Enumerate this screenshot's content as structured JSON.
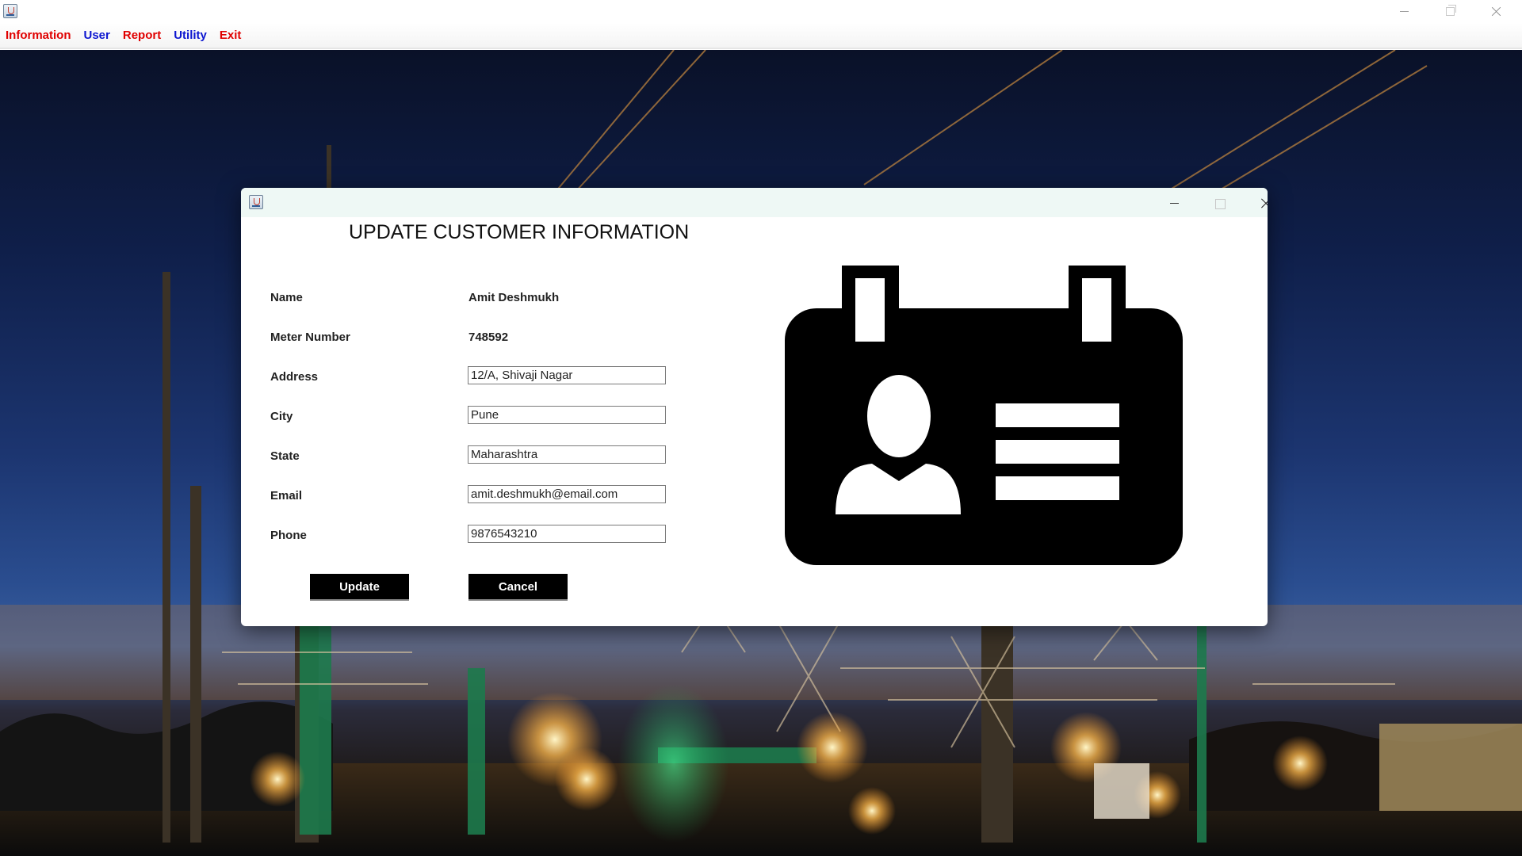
{
  "menu": {
    "items": [
      {
        "label": "Information",
        "color": "#e00000"
      },
      {
        "label": "User",
        "color": "#0c16d0"
      },
      {
        "label": "Report",
        "color": "#e00000"
      },
      {
        "label": "Utility",
        "color": "#0c16d0"
      },
      {
        "label": "Exit",
        "color": "#e00000"
      }
    ]
  },
  "dialog": {
    "heading": "UPDATE CUSTOMER INFORMATION",
    "fields": {
      "name": {
        "label": "Name",
        "value": "Amit Deshmukh"
      },
      "meter": {
        "label": "Meter Number",
        "value": "748592"
      },
      "address": {
        "label": "Address",
        "value": "12/A, Shivaji Nagar"
      },
      "city": {
        "label": "City",
        "value": "Pune"
      },
      "state": {
        "label": "State",
        "value": "Maharashtra"
      },
      "email": {
        "label": "Email",
        "value": "amit.deshmukh@email.com"
      },
      "phone": {
        "label": "Phone",
        "value": "9876543210"
      }
    },
    "buttons": {
      "update": "Update",
      "cancel": "Cancel"
    },
    "illustration_icon": "id-card-icon",
    "colors": {
      "button_bg": "#000000",
      "button_text": "#ffffff",
      "titlebar_bg": "#eef8f5"
    }
  },
  "background": {
    "subject": "electrical substation at dusk"
  }
}
